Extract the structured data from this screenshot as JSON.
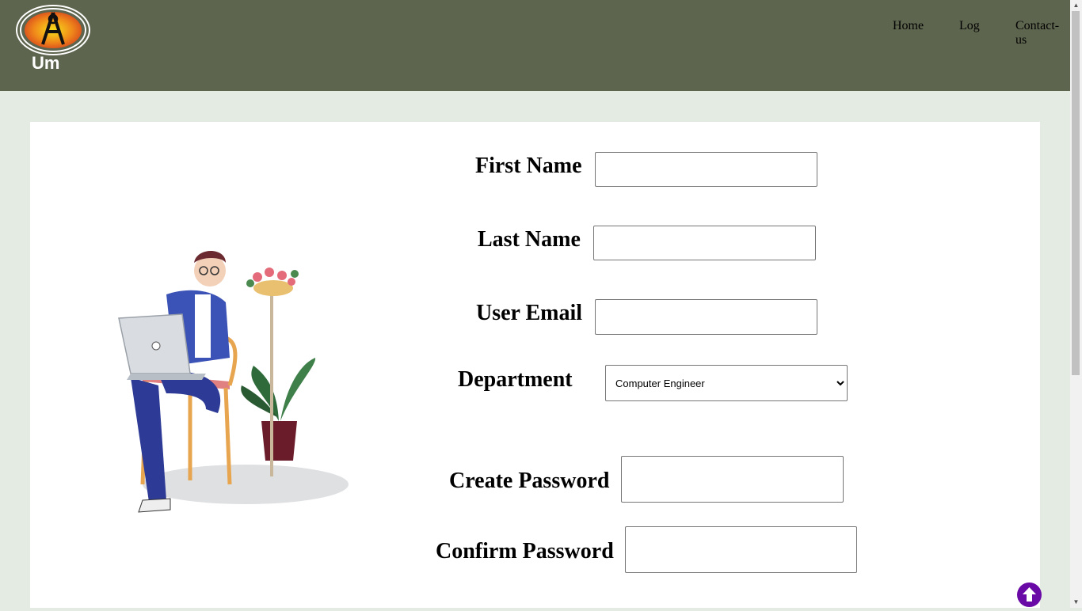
{
  "nav": {
    "items": [
      "Home",
      "Log",
      "Contact-us"
    ]
  },
  "logo": {
    "text": "Um",
    "letter": "A"
  },
  "form": {
    "first_name": {
      "label": "First Name",
      "value": "",
      "placeholder": ""
    },
    "last_name": {
      "label": "Last Name",
      "value": "",
      "placeholder": ""
    },
    "email": {
      "label": "User Email",
      "value": "",
      "placeholder": ""
    },
    "department": {
      "label": "Department",
      "selected": "Computer Engineer"
    },
    "create_password": {
      "label": "Create Password",
      "value": ""
    },
    "confirm_password": {
      "label": "Confirm Password",
      "value": ""
    }
  },
  "colors": {
    "header": "#5d654e",
    "page_bg": "#e3ebe3",
    "scroll_top_button": "#6a0aa6"
  },
  "icons": {
    "scroll_top": "arrow-up-circle-icon",
    "illustration": "person-with-laptop-illustration"
  }
}
